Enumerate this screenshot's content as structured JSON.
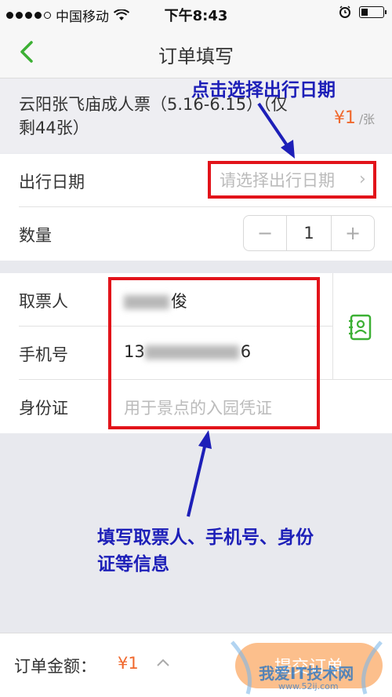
{
  "status_bar": {
    "carrier": "中国移动",
    "time": "下午8:43"
  },
  "nav": {
    "title": "订单填写"
  },
  "ticket": {
    "name": "云阳张飞庙成人票（5.16-6.15）（仅剩44张）",
    "price": "¥1",
    "unit": "/张"
  },
  "form": {
    "date_label": "出行日期",
    "date_placeholder": "请选择出行日期",
    "quantity_label": "数量",
    "quantity_minus": "−",
    "quantity_value": "1",
    "quantity_plus": "+",
    "ticket_holder_label": "取票人",
    "ticket_holder_value_visible": "俊",
    "phone_label": "手机号",
    "phone_value_prefix": "13",
    "phone_value_suffix": "6",
    "id_label": "身份证",
    "id_placeholder": "用于景点的入园凭证"
  },
  "annotations": {
    "top": "点击选择出行日期",
    "bottom": "填写取票人、手机号、身份证等信息"
  },
  "bottom_bar": {
    "total_label": "订单金额：",
    "total_value": "¥1",
    "submit_label": "提交订单"
  },
  "watermark": {
    "text": "我爱IT技术网",
    "url": "www.52ij.com"
  },
  "colors": {
    "accent_green": "#3cb034",
    "price_orange": "#f0682d",
    "annotation_blue": "#1d1fb8",
    "annotation_red": "#e2131a",
    "submit_bg": "#fcbf8c"
  }
}
